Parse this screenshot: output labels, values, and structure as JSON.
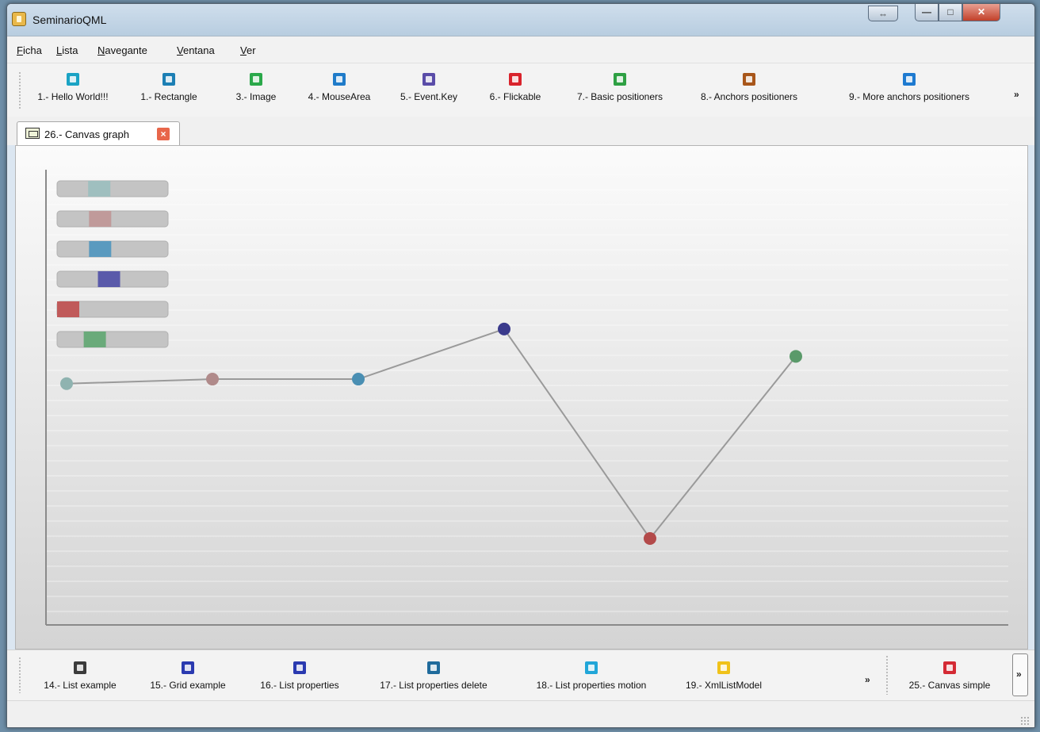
{
  "window": {
    "title": "SeminarioQML"
  },
  "menu": [
    {
      "label": "Ficha",
      "mnemonic": "F",
      "rest": "icha"
    },
    {
      "label": "Lista",
      "mnemonic": "L",
      "rest": "ista"
    },
    {
      "label": "Navegante",
      "mnemonic": "N",
      "rest": "avegante"
    },
    {
      "label": "Ventana",
      "mnemonic": "V",
      "rest": "entana"
    },
    {
      "label": "Ver",
      "mnemonic": "V",
      "rest": "er"
    }
  ],
  "toolbar_top": {
    "items": [
      {
        "label": "1.- Hello World!!!",
        "icon": "briefcase-icon",
        "color": "#1aa3c4"
      },
      {
        "label": "1.- Rectangle",
        "icon": "phone-icon",
        "color": "#1c7fb4"
      },
      {
        "label": "3.- Image",
        "icon": "image-icon",
        "color": "#2aa84a"
      },
      {
        "label": "4.- MouseArea",
        "icon": "airplane-icon",
        "color": "#1f7bc9"
      },
      {
        "label": "5.- Event.Key",
        "icon": "keyboard-icon",
        "color": "#5a4ca8"
      },
      {
        "label": "6.- Flickable",
        "icon": "flick-icon",
        "color": "#d9232c"
      },
      {
        "label": "7.- Basic positioners",
        "icon": "page-icon",
        "color": "#2ea043"
      },
      {
        "label": "8.- Anchors positioners",
        "icon": "anchor-icon",
        "color": "#a8561a"
      },
      {
        "label": "9.- More anchors positioners",
        "icon": "device-icon",
        "color": "#1e7ad0"
      }
    ],
    "overflow": "»"
  },
  "tab": {
    "label": "26.- Canvas graph",
    "close": "×"
  },
  "toolbar_bottom": {
    "items": [
      {
        "label": "14.- List example",
        "icon": "flag-icon",
        "color": "#3b3b3b"
      },
      {
        "label": "15.- Grid example",
        "icon": "flag-icon",
        "color": "#2a3ab0"
      },
      {
        "label": "16.- List properties",
        "icon": "flag-icon",
        "color": "#2a3ab0"
      },
      {
        "label": "17.- List properties delete",
        "icon": "refresh-icon",
        "color": "#1f6b9c"
      },
      {
        "label": "18.- List properties motion",
        "icon": "window-icon",
        "color": "#21a6d8"
      },
      {
        "label": "19.- XmlListModel",
        "icon": "power-icon",
        "color": "#f0c21a"
      }
    ],
    "overflow": "»",
    "end_item": {
      "label": "25.- Canvas simple",
      "icon": "rocket-icon",
      "color": "#d42a34"
    },
    "end_overflow": "»"
  },
  "chart_data": {
    "type": "line",
    "x": [
      1,
      2,
      3,
      4,
      5,
      6
    ],
    "values": [
      53,
      54,
      54,
      65,
      19,
      59
    ],
    "point_colors": [
      "#8fb3b0",
      "#b08a8a",
      "#4a8fb3",
      "#3a3a8c",
      "#b34a4a",
      "#5a9a6a"
    ],
    "legend_colors": [
      "#9fbfbf",
      "#c09a9a",
      "#5a9abf",
      "#5a5aaa",
      "#c05a5a",
      "#6aaa7a"
    ],
    "legend_slider_levels": [
      0.35,
      0.36,
      0.36,
      0.46,
      0.0,
      0.3
    ],
    "ylim": [
      0,
      100
    ],
    "grid": true,
    "legend": "top-left"
  }
}
